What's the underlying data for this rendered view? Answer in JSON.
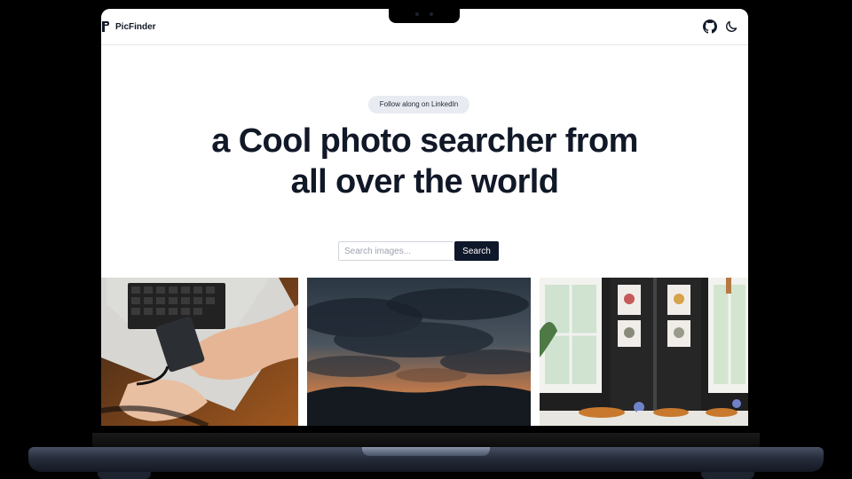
{
  "app": {
    "name": "PicFinder"
  },
  "header": {
    "github_icon": "github-icon",
    "theme_icon": "moon-icon"
  },
  "hero": {
    "badge": "Follow along on LinkedIn",
    "headline_line1": "a Cool photo searcher from",
    "headline_line2": "all over the world"
  },
  "search": {
    "placeholder": "Search images...",
    "value": "",
    "button_label": "Search"
  },
  "gallery": {
    "images": [
      {
        "subject": "hands holding a portable SSD next to a laptop"
      },
      {
        "subject": "sunset sky with dark clouds over mountains"
      },
      {
        "subject": "room interior with framed pictures, windows and plants"
      }
    ]
  },
  "colors": {
    "primary_button": "#0f172a",
    "headline": "#111827",
    "badge_bg": "#e8ebf1"
  }
}
